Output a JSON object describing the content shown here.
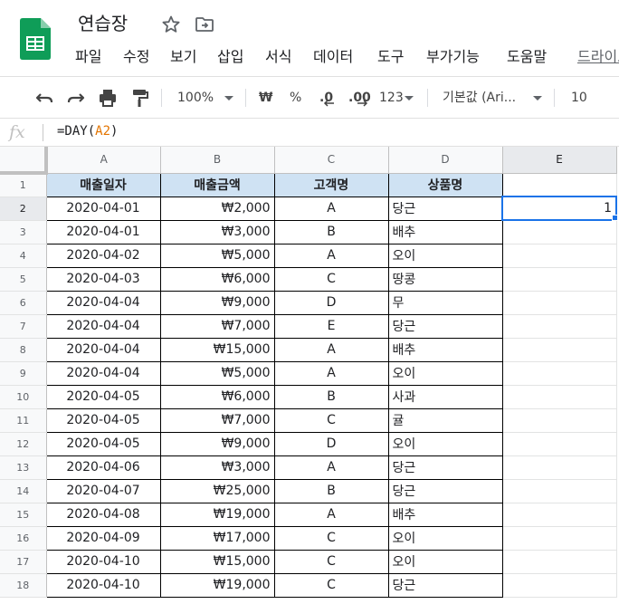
{
  "doc": {
    "title": "연습장"
  },
  "menu": [
    "파일",
    "수정",
    "보기",
    "삽입",
    "서식",
    "데이터",
    "도구",
    "부가기능",
    "도움말",
    "드라이브"
  ],
  "toolbar": {
    "zoom": "100%",
    "currency": "₩",
    "percent": "%",
    "decimal_decrease": ".0",
    "decimal_increase": ".00",
    "number_format": "123",
    "font": "기본값 (Ari...",
    "font_size": "10"
  },
  "formula": {
    "fx": "fx",
    "prefix": "=DAY(",
    "ref": "A2",
    "suffix": ")"
  },
  "columns": [
    "A",
    "B",
    "C",
    "D",
    "E"
  ],
  "rows": [
    "1",
    "2",
    "3",
    "4",
    "5",
    "6",
    "7",
    "8",
    "9",
    "10",
    "11",
    "12",
    "13",
    "14",
    "15",
    "16",
    "17",
    "18"
  ],
  "table": {
    "headers": [
      "매출일자",
      "매출금액",
      "고객명",
      "상품명"
    ],
    "rows": [
      [
        "2020-04-01",
        "₩2,000",
        "A",
        "당근"
      ],
      [
        "2020-04-01",
        "₩3,000",
        "B",
        "배추"
      ],
      [
        "2020-04-02",
        "₩5,000",
        "A",
        "오이"
      ],
      [
        "2020-04-03",
        "₩6,000",
        "C",
        "땅콩"
      ],
      [
        "2020-04-04",
        "₩9,000",
        "D",
        "무"
      ],
      [
        "2020-04-04",
        "₩7,000",
        "E",
        "당근"
      ],
      [
        "2020-04-04",
        "₩15,000",
        "A",
        "배추"
      ],
      [
        "2020-04-04",
        "₩5,000",
        "A",
        "오이"
      ],
      [
        "2020-04-05",
        "₩6,000",
        "B",
        "사과"
      ],
      [
        "2020-04-05",
        "₩7,000",
        "C",
        "귤"
      ],
      [
        "2020-04-05",
        "₩9,000",
        "D",
        "오이"
      ],
      [
        "2020-04-06",
        "₩3,000",
        "A",
        "당근"
      ],
      [
        "2020-04-07",
        "₩25,000",
        "B",
        "당근"
      ],
      [
        "2020-04-08",
        "₩19,000",
        "A",
        "배추"
      ],
      [
        "2020-04-09",
        "₩17,000",
        "C",
        "오이"
      ],
      [
        "2020-04-10",
        "₩15,000",
        "C",
        "오이"
      ],
      [
        "2020-04-10",
        "₩19,000",
        "C",
        "당근"
      ]
    ]
  },
  "selected_cell": {
    "ref": "E2",
    "value": "1"
  },
  "colors": {
    "header_fill": "#cfe2f3",
    "selection": "#1a73e8",
    "formula_ref": "#e37400"
  }
}
